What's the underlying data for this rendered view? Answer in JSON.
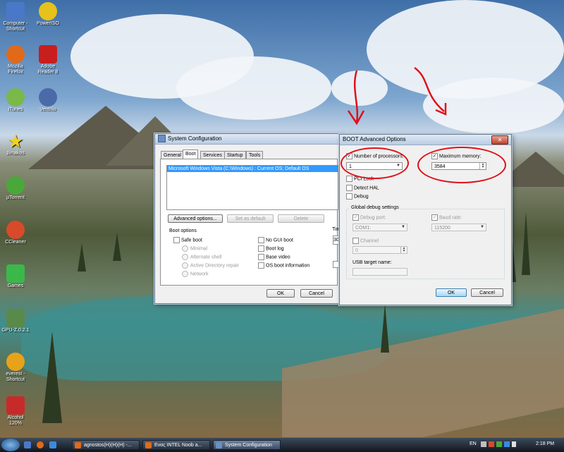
{
  "desktop": {
    "icons": [
      {
        "label": "Computer - Shortcut",
        "icon": "computer-icon",
        "color": "#4a78c8"
      },
      {
        "label": "PowerISO",
        "icon": "disc-icon",
        "color": "#e6c21a"
      },
      {
        "label": "Mozilla Firefox",
        "icon": "firefox-icon",
        "color": "#e06a1a"
      },
      {
        "label": "Adobe Reader 8",
        "icon": "pdf-icon",
        "color": "#c81e1e"
      },
      {
        "label": "iTunes",
        "icon": "music-icon",
        "color": "#7ab84a"
      },
      {
        "label": "Ventrilo",
        "icon": "headset-icon",
        "color": "#4a6aa8"
      },
      {
        "label": "Jimakos",
        "icon": "star-icon",
        "color": "#f2d21a"
      },
      {
        "label": "µTorrent",
        "icon": "utorrent-icon",
        "color": "#4aa83a"
      },
      {
        "label": "CCleaner",
        "icon": "ccleaner-icon",
        "color": "#d84a2a"
      },
      {
        "label": "Games",
        "icon": "games-icon",
        "color": "#3ab84a"
      },
      {
        "label": "GPU-Z.0.2.1",
        "icon": "gpu-icon",
        "color": "#5a8a4a"
      },
      {
        "label": "everest - Shortcut",
        "icon": "info-icon",
        "color": "#e8a21a"
      },
      {
        "label": "Alcohol 120%",
        "icon": "alcohol-icon",
        "color": "#c82a2a"
      }
    ]
  },
  "sysconfig": {
    "title": "System Configuration",
    "tabs": [
      "General",
      "Boot",
      "Services",
      "Startup",
      "Tools"
    ],
    "active_tab": "Boot",
    "os_entry": "Microsoft Windows Vista (C:\\Windows) : Current OS; Default OS",
    "advanced_label": "Advanced options...",
    "set_default_label": "Set as default",
    "delete_label": "Delete",
    "boot_options_label": "Boot options",
    "safe_boot": "Safe boot",
    "minimal": "Minimal",
    "alternate_shell": "Alternate shell",
    "ad_repair": "Active Directory repair",
    "network": "Network",
    "no_gui": "No GUI boot",
    "boot_log": "Boot log",
    "base_video": "Base video",
    "os_boot_info": "OS boot information",
    "timeout_partial": "Tim",
    "timeout_value_partial": "30",
    "ok": "OK",
    "cancel": "Cancel"
  },
  "advanced": {
    "title": "BOOT Advanced Options",
    "num_proc_label": "Number of processors:",
    "num_proc_value": "1",
    "max_mem_label": "Maximum memory:",
    "max_mem_value": "3584",
    "pci_lock": "PCI Lock",
    "detect_hal": "Detect HAL",
    "debug": "Debug",
    "global_debug_label": "Global debug settings",
    "debug_port_label": "Debug port:",
    "debug_port_value": "COM1:",
    "baud_rate_label": "Baud rate:",
    "baud_rate_value": "115200",
    "channel_label": "Channel",
    "channel_value": "0",
    "usb_target_label": "USB target name:",
    "ok": "OK",
    "cancel": "Cancel",
    "close_glyph": "✕"
  },
  "taskbar": {
    "items": [
      {
        "label": "agnostos(H)(H)(H) -..."
      },
      {
        "label": "Ενας INTEL Noob a..."
      },
      {
        "label": "System Configuration"
      }
    ],
    "language": "EN",
    "clock": "2:18 PM"
  },
  "colors": {
    "annotation_red": "#e0101a",
    "selection_blue": "#3399ff"
  }
}
